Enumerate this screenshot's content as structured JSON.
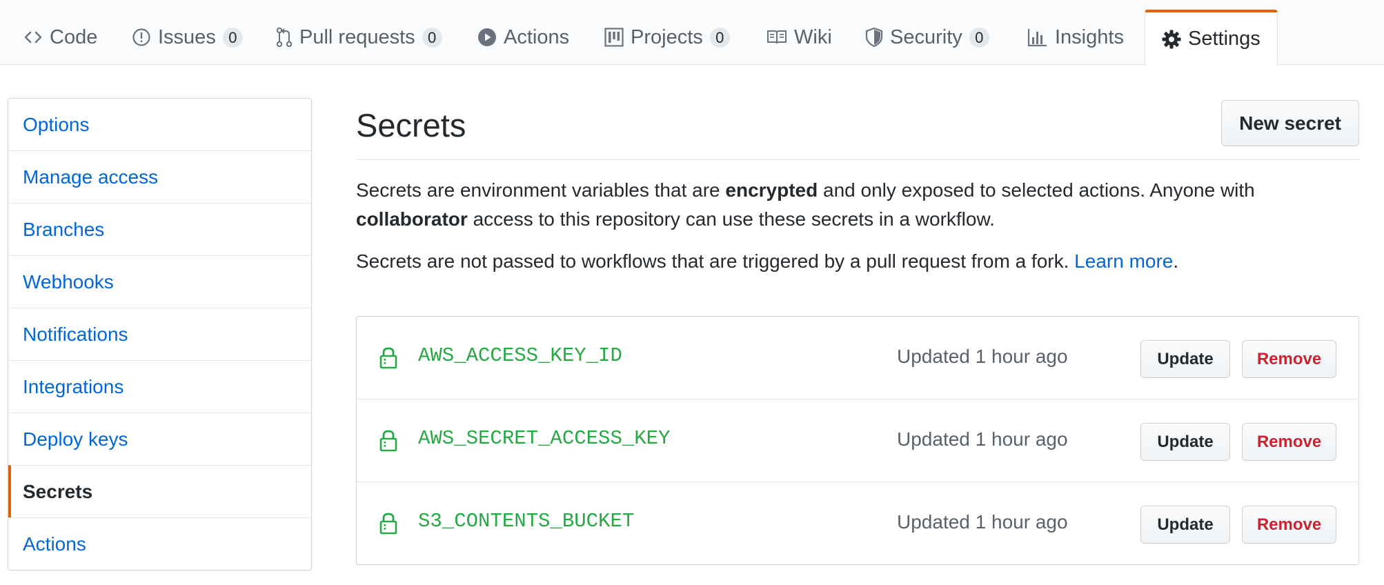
{
  "tabs": [
    {
      "label": "Code",
      "icon": "code-icon"
    },
    {
      "label": "Issues",
      "icon": "issue-icon",
      "count": "0"
    },
    {
      "label": "Pull requests",
      "icon": "pull-request-icon",
      "count": "0"
    },
    {
      "label": "Actions",
      "icon": "play-icon"
    },
    {
      "label": "Projects",
      "icon": "project-icon",
      "count": "0"
    },
    {
      "label": "Wiki",
      "icon": "book-icon"
    },
    {
      "label": "Security",
      "icon": "shield-icon",
      "count": "0"
    },
    {
      "label": "Insights",
      "icon": "graph-icon"
    },
    {
      "label": "Settings",
      "icon": "gear-icon",
      "selected": true
    }
  ],
  "sidebar": {
    "items": [
      {
        "label": "Options"
      },
      {
        "label": "Manage access"
      },
      {
        "label": "Branches"
      },
      {
        "label": "Webhooks"
      },
      {
        "label": "Notifications"
      },
      {
        "label": "Integrations"
      },
      {
        "label": "Deploy keys"
      },
      {
        "label": "Secrets",
        "selected": true
      },
      {
        "label": "Actions"
      }
    ]
  },
  "main": {
    "title": "Secrets",
    "new_secret_label": "New secret",
    "desc1": {
      "part1": "Secrets are environment variables that are ",
      "bold1": "encrypted",
      "part2": " and only exposed to selected actions. Anyone with ",
      "bold2": "collaborator",
      "part3": " access to this repository can use these secrets in a workflow."
    },
    "desc2": {
      "text": "Secrets are not passed to workflows that are triggered by a pull request from a fork. ",
      "link": "Learn more",
      "end": "."
    },
    "secrets": [
      {
        "name": "AWS_ACCESS_KEY_ID",
        "updated": "Updated 1 hour ago",
        "update_label": "Update",
        "remove_label": "Remove"
      },
      {
        "name": "AWS_SECRET_ACCESS_KEY",
        "updated": "Updated 1 hour ago",
        "update_label": "Update",
        "remove_label": "Remove"
      },
      {
        "name": "S3_CONTENTS_BUCKET",
        "updated": "Updated 1 hour ago",
        "update_label": "Update",
        "remove_label": "Remove"
      }
    ]
  },
  "colors": {
    "link": "#0366d6",
    "accent_orange": "#e36209",
    "secret_green": "#28a745",
    "danger_red": "#cb2431"
  }
}
